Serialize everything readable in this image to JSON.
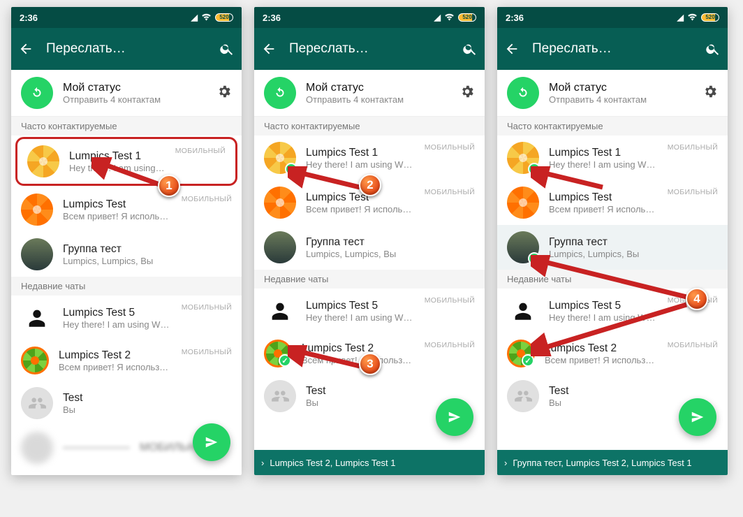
{
  "status": {
    "time": "2:36",
    "battery": "520"
  },
  "appbar": {
    "title": "Переслать…"
  },
  "mystatus": {
    "title": "Мой статус",
    "subtitle": "Отправить 4 контактам"
  },
  "sections": {
    "freq": "Часто контактируемые",
    "recent": "Недавние чаты"
  },
  "tag": {
    "mobile": "МОБИЛЬНЫЙ"
  },
  "contacts": {
    "c1": {
      "name": "Lumpics Test 1",
      "status": "Hey there! I am using WhatsApp."
    },
    "c2": {
      "name": "Lumpics Test",
      "status": "Всем привет! Я использую WhatsApp."
    },
    "c3": {
      "name": "Группа тест",
      "status": "Lumpics, Lumpics, Вы"
    },
    "c4": {
      "name": "Lumpics Test 5",
      "status": "Hey there! I am using WhatsApp."
    },
    "c5": {
      "name": "Lumpics Test 2",
      "status": "Всем привет! Я использую WhatsApp."
    },
    "c6": {
      "name": "Test",
      "status": "Вы"
    }
  },
  "bottombar": {
    "p2": "Lumpics Test 2, Lumpics Test 1",
    "p3": "Группа тест, Lumpics Test 2, Lumpics Test 1"
  },
  "markers": {
    "m1": "1",
    "m2": "2",
    "m3": "3",
    "m4": "4"
  }
}
